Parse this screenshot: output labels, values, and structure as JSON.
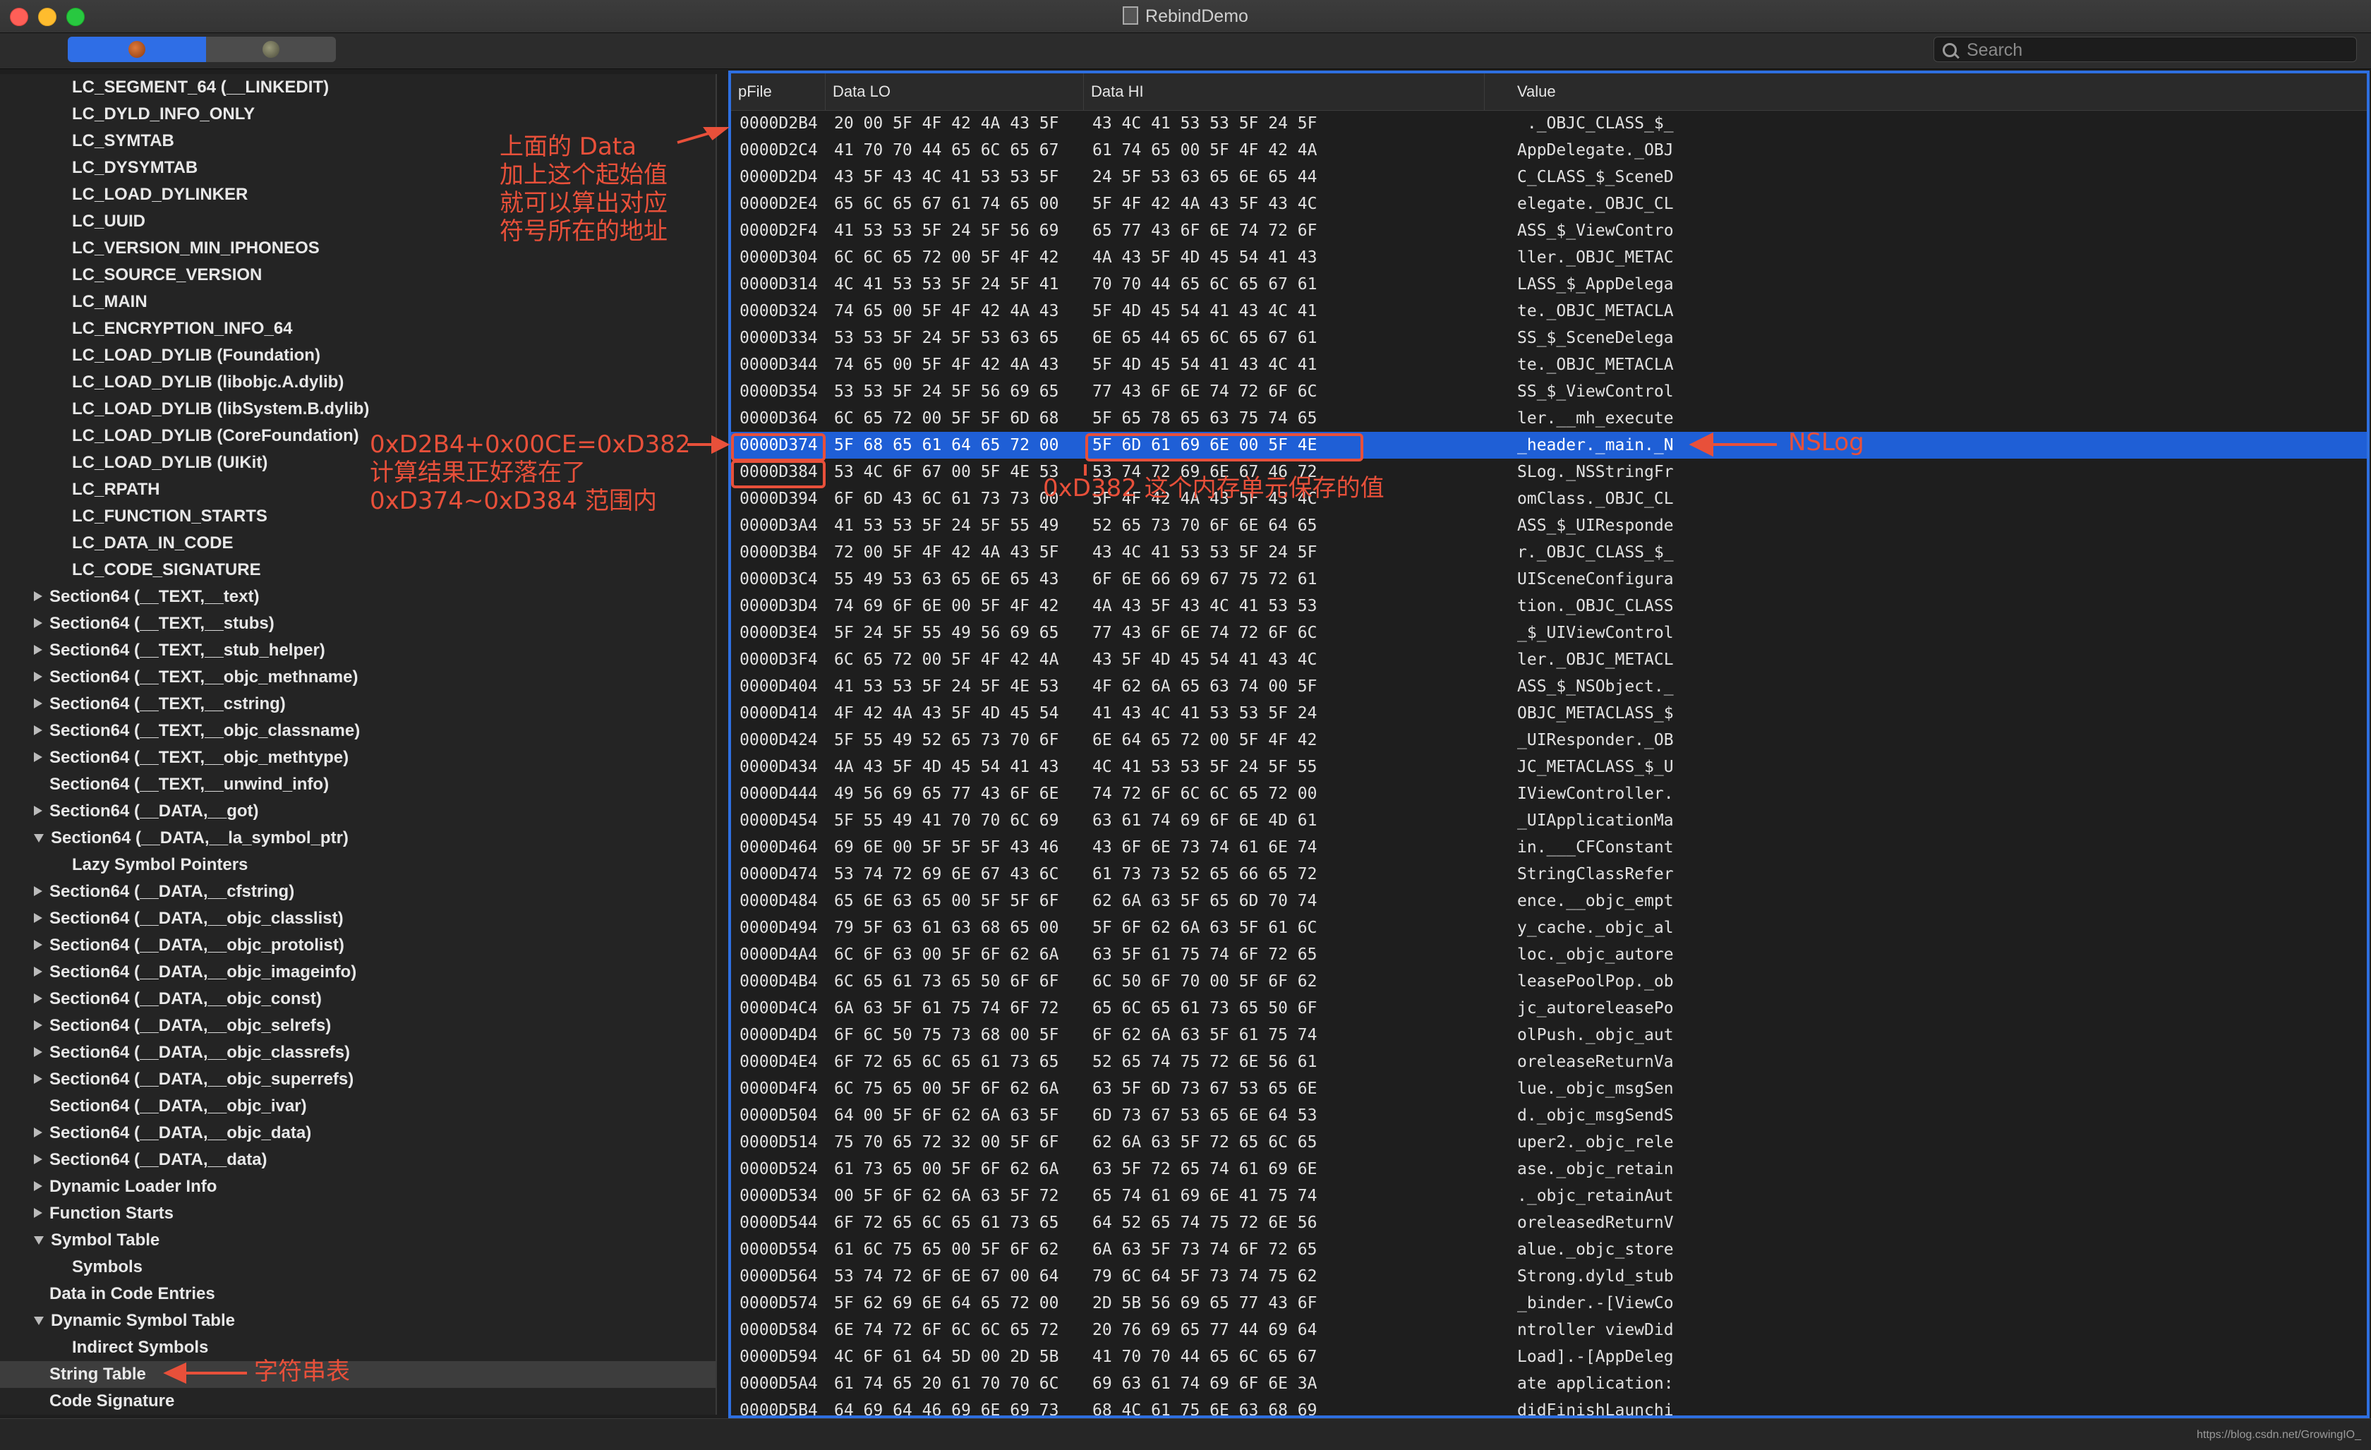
{
  "window": {
    "title": "RebindDemo"
  },
  "search": {
    "placeholder": "Search"
  },
  "sidebar": {
    "items": [
      {
        "label": "LC_SEGMENT_64 (__LINKEDIT)",
        "indent": 2,
        "toggle": "none"
      },
      {
        "label": "LC_DYLD_INFO_ONLY",
        "indent": 2,
        "toggle": "none"
      },
      {
        "label": "LC_SYMTAB",
        "indent": 2,
        "toggle": "none"
      },
      {
        "label": "LC_DYSYMTAB",
        "indent": 2,
        "toggle": "none"
      },
      {
        "label": "LC_LOAD_DYLINKER",
        "indent": 2,
        "toggle": "none"
      },
      {
        "label": "LC_UUID",
        "indent": 2,
        "toggle": "none"
      },
      {
        "label": "LC_VERSION_MIN_IPHONEOS",
        "indent": 2,
        "toggle": "none"
      },
      {
        "label": "LC_SOURCE_VERSION",
        "indent": 2,
        "toggle": "none"
      },
      {
        "label": "LC_MAIN",
        "indent": 2,
        "toggle": "none"
      },
      {
        "label": "LC_ENCRYPTION_INFO_64",
        "indent": 2,
        "toggle": "none"
      },
      {
        "label": "LC_LOAD_DYLIB (Foundation)",
        "indent": 2,
        "toggle": "none"
      },
      {
        "label": "LC_LOAD_DYLIB (libobjc.A.dylib)",
        "indent": 2,
        "toggle": "none"
      },
      {
        "label": "LC_LOAD_DYLIB (libSystem.B.dylib)",
        "indent": 2,
        "toggle": "none"
      },
      {
        "label": "LC_LOAD_DYLIB (CoreFoundation)",
        "indent": 2,
        "toggle": "none"
      },
      {
        "label": "LC_LOAD_DYLIB (UIKit)",
        "indent": 2,
        "toggle": "none"
      },
      {
        "label": "LC_RPATH",
        "indent": 2,
        "toggle": "none"
      },
      {
        "label": "LC_FUNCTION_STARTS",
        "indent": 2,
        "toggle": "none"
      },
      {
        "label": "LC_DATA_IN_CODE",
        "indent": 2,
        "toggle": "none"
      },
      {
        "label": "LC_CODE_SIGNATURE",
        "indent": 2,
        "toggle": "none"
      },
      {
        "label": "Section64 (__TEXT,__text)",
        "indent": 1,
        "toggle": "closed"
      },
      {
        "label": "Section64 (__TEXT,__stubs)",
        "indent": 1,
        "toggle": "closed"
      },
      {
        "label": "Section64 (__TEXT,__stub_helper)",
        "indent": 1,
        "toggle": "closed"
      },
      {
        "label": "Section64 (__TEXT,__objc_methname)",
        "indent": 1,
        "toggle": "closed"
      },
      {
        "label": "Section64 (__TEXT,__cstring)",
        "indent": 1,
        "toggle": "closed"
      },
      {
        "label": "Section64 (__TEXT,__objc_classname)",
        "indent": 1,
        "toggle": "closed"
      },
      {
        "label": "Section64 (__TEXT,__objc_methtype)",
        "indent": 1,
        "toggle": "closed"
      },
      {
        "label": "Section64 (__TEXT,__unwind_info)",
        "indent": 1,
        "toggle": "none"
      },
      {
        "label": "Section64 (__DATA,__got)",
        "indent": 1,
        "toggle": "closed"
      },
      {
        "label": "Section64 (__DATA,__la_symbol_ptr)",
        "indent": 1,
        "toggle": "open"
      },
      {
        "label": "Lazy Symbol Pointers",
        "indent": 2,
        "toggle": "none"
      },
      {
        "label": "Section64 (__DATA,__cfstring)",
        "indent": 1,
        "toggle": "closed"
      },
      {
        "label": "Section64 (__DATA,__objc_classlist)",
        "indent": 1,
        "toggle": "closed"
      },
      {
        "label": "Section64 (__DATA,__objc_protolist)",
        "indent": 1,
        "toggle": "closed"
      },
      {
        "label": "Section64 (__DATA,__objc_imageinfo)",
        "indent": 1,
        "toggle": "closed"
      },
      {
        "label": "Section64 (__DATA,__objc_const)",
        "indent": 1,
        "toggle": "closed"
      },
      {
        "label": "Section64 (__DATA,__objc_selrefs)",
        "indent": 1,
        "toggle": "closed"
      },
      {
        "label": "Section64 (__DATA,__objc_classrefs)",
        "indent": 1,
        "toggle": "closed"
      },
      {
        "label": "Section64 (__DATA,__objc_superrefs)",
        "indent": 1,
        "toggle": "closed"
      },
      {
        "label": "Section64 (__DATA,__objc_ivar)",
        "indent": 1,
        "toggle": "none"
      },
      {
        "label": "Section64 (__DATA,__objc_data)",
        "indent": 1,
        "toggle": "closed"
      },
      {
        "label": "Section64 (__DATA,__data)",
        "indent": 1,
        "toggle": "closed"
      },
      {
        "label": "Dynamic Loader Info",
        "indent": 1,
        "toggle": "closed"
      },
      {
        "label": "Function Starts",
        "indent": 1,
        "toggle": "closed"
      },
      {
        "label": "Symbol Table",
        "indent": 1,
        "toggle": "open"
      },
      {
        "label": "Symbols",
        "indent": 2,
        "toggle": "none"
      },
      {
        "label": "Data in Code Entries",
        "indent": 1,
        "toggle": "none"
      },
      {
        "label": "Dynamic Symbol Table",
        "indent": 1,
        "toggle": "open"
      },
      {
        "label": "Indirect Symbols",
        "indent": 2,
        "toggle": "none"
      },
      {
        "label": "String Table",
        "indent": 1,
        "toggle": "none",
        "selected": true
      },
      {
        "label": "Code Signature",
        "indent": 1,
        "toggle": "none"
      }
    ]
  },
  "table": {
    "columns": [
      "pFile",
      "Data LO",
      "Data HI",
      "Value"
    ],
    "rows": [
      [
        "0000D2B4",
        "20 00 5F 4F 42 4A 43 5F",
        "43 4C 41 53 53 5F 24 5F",
        " ._OBJC_CLASS_$_"
      ],
      [
        "0000D2C4",
        "41 70 70 44 65 6C 65 67",
        "61 74 65 00 5F 4F 42 4A",
        "AppDelegate._OBJ"
      ],
      [
        "0000D2D4",
        "43 5F 43 4C 41 53 53 5F",
        "24 5F 53 63 65 6E 65 44",
        "C_CLASS_$_SceneD"
      ],
      [
        "0000D2E4",
        "65 6C 65 67 61 74 65 00",
        "5F 4F 42 4A 43 5F 43 4C",
        "elegate._OBJC_CL"
      ],
      [
        "0000D2F4",
        "41 53 53 5F 24 5F 56 69",
        "65 77 43 6F 6E 74 72 6F",
        "ASS_$_ViewContro"
      ],
      [
        "0000D304",
        "6C 6C 65 72 00 5F 4F 42",
        "4A 43 5F 4D 45 54 41 43",
        "ller._OBJC_METAC"
      ],
      [
        "0000D314",
        "4C 41 53 53 5F 24 5F 41",
        "70 70 44 65 6C 65 67 61",
        "LASS_$_AppDelega"
      ],
      [
        "0000D324",
        "74 65 00 5F 4F 42 4A 43",
        "5F 4D 45 54 41 43 4C 41",
        "te._OBJC_METACLA"
      ],
      [
        "0000D334",
        "53 53 5F 24 5F 53 63 65",
        "6E 65 44 65 6C 65 67 61",
        "SS_$_SceneDelega"
      ],
      [
        "0000D344",
        "74 65 00 5F 4F 42 4A 43",
        "5F 4D 45 54 41 43 4C 41",
        "te._OBJC_METACLA"
      ],
      [
        "0000D354",
        "53 53 5F 24 5F 56 69 65",
        "77 43 6F 6E 74 72 6F 6C",
        "SS_$_ViewControl"
      ],
      [
        "0000D364",
        "6C 65 72 00 5F 5F 6D 68",
        "5F 65 78 65 63 75 74 65",
        "ler.__mh_execute"
      ],
      [
        "0000D374",
        "5F 68 65 61 64 65 72 00",
        "5F 6D 61 69 6E 00 5F 4E",
        "_header._main._N"
      ],
      [
        "0000D384",
        "53 4C 6F 67 00 5F 4E 53",
        "53 74 72 69 6E 67 46 72",
        "SLog._NSStringFr"
      ],
      [
        "0000D394",
        "6F 6D 43 6C 61 73 73 00",
        "5F 4F 42 4A 43 5F 43 4C",
        "omClass._OBJC_CL"
      ],
      [
        "0000D3A4",
        "41 53 53 5F 24 5F 55 49",
        "52 65 73 70 6F 6E 64 65",
        "ASS_$_UIResponde"
      ],
      [
        "0000D3B4",
        "72 00 5F 4F 42 4A 43 5F",
        "43 4C 41 53 53 5F 24 5F",
        "r._OBJC_CLASS_$_"
      ],
      [
        "0000D3C4",
        "55 49 53 63 65 6E 65 43",
        "6F 6E 66 69 67 75 72 61",
        "UISceneConfigura"
      ],
      [
        "0000D3D4",
        "74 69 6F 6E 00 5F 4F 42",
        "4A 43 5F 43 4C 41 53 53",
        "tion._OBJC_CLASS"
      ],
      [
        "0000D3E4",
        "5F 24 5F 55 49 56 69 65",
        "77 43 6F 6E 74 72 6F 6C",
        "_$_UIViewControl"
      ],
      [
        "0000D3F4",
        "6C 65 72 00 5F 4F 42 4A",
        "43 5F 4D 45 54 41 43 4C",
        "ler._OBJC_METACL"
      ],
      [
        "0000D404",
        "41 53 53 5F 24 5F 4E 53",
        "4F 62 6A 65 63 74 00 5F",
        "ASS_$_NSObject._"
      ],
      [
        "0000D414",
        "4F 42 4A 43 5F 4D 45 54",
        "41 43 4C 41 53 53 5F 24",
        "OBJC_METACLASS_$"
      ],
      [
        "0000D424",
        "5F 55 49 52 65 73 70 6F",
        "6E 64 65 72 00 5F 4F 42",
        "_UIResponder._OB"
      ],
      [
        "0000D434",
        "4A 43 5F 4D 45 54 41 43",
        "4C 41 53 53 5F 24 5F 55",
        "JC_METACLASS_$_U"
      ],
      [
        "0000D444",
        "49 56 69 65 77 43 6F 6E",
        "74 72 6F 6C 6C 65 72 00",
        "IViewController."
      ],
      [
        "0000D454",
        "5F 55 49 41 70 70 6C 69",
        "63 61 74 69 6F 6E 4D 61",
        "_UIApplicationMa"
      ],
      [
        "0000D464",
        "69 6E 00 5F 5F 5F 43 46",
        "43 6F 6E 73 74 61 6E 74",
        "in.___CFConstant"
      ],
      [
        "0000D474",
        "53 74 72 69 6E 67 43 6C",
        "61 73 73 52 65 66 65 72",
        "StringClassRefer"
      ],
      [
        "0000D484",
        "65 6E 63 65 00 5F 5F 6F",
        "62 6A 63 5F 65 6D 70 74",
        "ence.__objc_empt"
      ],
      [
        "0000D494",
        "79 5F 63 61 63 68 65 00",
        "5F 6F 62 6A 63 5F 61 6C",
        "y_cache._objc_al"
      ],
      [
        "0000D4A4",
        "6C 6F 63 00 5F 6F 62 6A",
        "63 5F 61 75 74 6F 72 65",
        "loc._objc_autore"
      ],
      [
        "0000D4B4",
        "6C 65 61 73 65 50 6F 6F",
        "6C 50 6F 70 00 5F 6F 62",
        "leasePoolPop._ob"
      ],
      [
        "0000D4C4",
        "6A 63 5F 61 75 74 6F 72",
        "65 6C 65 61 73 65 50 6F",
        "jc_autoreleasePo"
      ],
      [
        "0000D4D4",
        "6F 6C 50 75 73 68 00 5F",
        "6F 62 6A 63 5F 61 75 74",
        "olPush._objc_aut"
      ],
      [
        "0000D4E4",
        "6F 72 65 6C 65 61 73 65",
        "52 65 74 75 72 6E 56 61",
        "oreleaseReturnVa"
      ],
      [
        "0000D4F4",
        "6C 75 65 00 5F 6F 62 6A",
        "63 5F 6D 73 67 53 65 6E",
        "lue._objc_msgSen"
      ],
      [
        "0000D504",
        "64 00 5F 6F 62 6A 63 5F",
        "6D 73 67 53 65 6E 64 53",
        "d._objc_msgSendS"
      ],
      [
        "0000D514",
        "75 70 65 72 32 00 5F 6F",
        "62 6A 63 5F 72 65 6C 65",
        "uper2._objc_rele"
      ],
      [
        "0000D524",
        "61 73 65 00 5F 6F 62 6A",
        "63 5F 72 65 74 61 69 6E",
        "ase._objc_retain"
      ],
      [
        "0000D534",
        "00 5F 6F 62 6A 63 5F 72",
        "65 74 61 69 6E 41 75 74",
        "._objc_retainAut"
      ],
      [
        "0000D544",
        "6F 72 65 6C 65 61 73 65",
        "64 52 65 74 75 72 6E 56",
        "oreleasedReturnV"
      ],
      [
        "0000D554",
        "61 6C 75 65 00 5F 6F 62",
        "6A 63 5F 73 74 6F 72 65",
        "alue._objc_store"
      ],
      [
        "0000D564",
        "53 74 72 6F 6E 67 00 64",
        "79 6C 64 5F 73 74 75 62",
        "Strong.dyld_stub"
      ],
      [
        "0000D574",
        "5F 62 69 6E 64 65 72 00",
        "2D 5B 56 69 65 77 43 6F",
        "_binder.-[ViewCo"
      ],
      [
        "0000D584",
        "6E 74 72 6F 6C 6C 65 72",
        "20 76 69 65 77 44 69 64",
        "ntroller viewDid"
      ],
      [
        "0000D594",
        "4C 6F 61 64 5D 00 2D 5B",
        "41 70 70 44 65 6C 65 67",
        "Load].-[AppDeleg"
      ],
      [
        "0000D5A4",
        "61 74 65 20 61 70 70 6C",
        "69 63 61 74 69 6F 6E 3A",
        "ate application:"
      ],
      [
        "0000D5B4",
        "64 69 64 46 69 6E 69 73",
        "68 4C 61 75 6E 63 68 69",
        "didFinishLaunchi"
      ]
    ],
    "selected_row": 12
  },
  "annotations": {
    "data_note": [
      "上面的 Data",
      "加上这个起始值",
      "就可以算出对应",
      "符号所在的地址"
    ],
    "calc_note": [
      "0xD2B4+0x00CE=0xD382",
      "计算结果正好落在了",
      "0xD374~0xD384 范围内"
    ],
    "cell_note": "0xD382 这个内存单元保存的值",
    "nslog_note": "NSLog",
    "string_table_note": "字符串表"
  },
  "status": {
    "credit": "https://blog.csdn.net/GrowingIO_"
  },
  "colors": {
    "accent": "#2e6fe0",
    "selection": "#1f5fd6",
    "annotation": "#e8503a"
  }
}
